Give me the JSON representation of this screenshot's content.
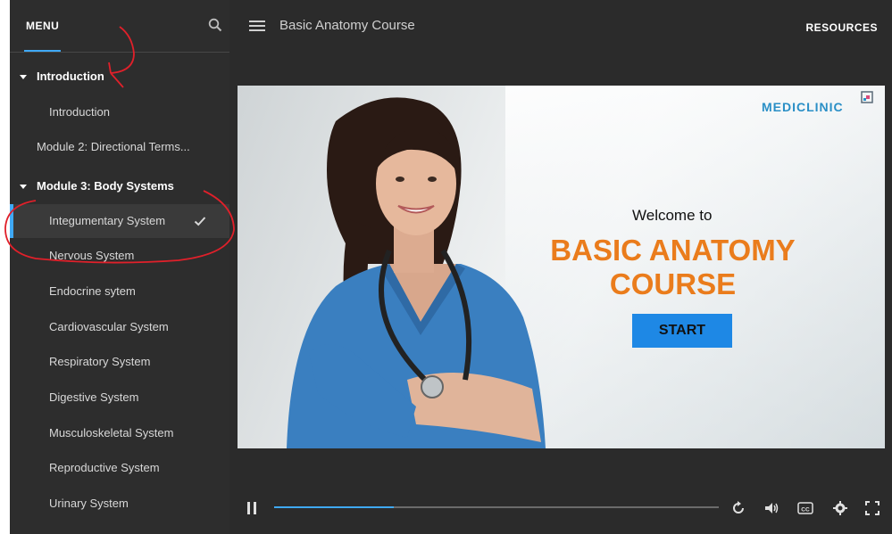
{
  "sidebar": {
    "menu_label": "MENU",
    "items": [
      {
        "label": "Introduction",
        "type": "section"
      },
      {
        "label": "Introduction",
        "type": "child"
      },
      {
        "label": "Module 2: Directional Terms...",
        "type": "top"
      },
      {
        "label": "Module 3: Body Systems",
        "type": "section"
      },
      {
        "label": "Integumentary System",
        "type": "child",
        "active": true,
        "completed": true
      },
      {
        "label": "Nervous System",
        "type": "child"
      },
      {
        "label": "Endocrine sytem",
        "type": "child"
      },
      {
        "label": "Cardiovascular System",
        "type": "child"
      },
      {
        "label": "Respiratory System",
        "type": "child"
      },
      {
        "label": "Digestive System",
        "type": "child"
      },
      {
        "label": "Musculoskeletal System",
        "type": "child"
      },
      {
        "label": "Reproductive System",
        "type": "child"
      },
      {
        "label": "Urinary System",
        "type": "child"
      }
    ]
  },
  "header": {
    "course_title": "Basic Anatomy Course",
    "resources_label": "RESOURCES"
  },
  "slide": {
    "logo": "MEDICLINIC",
    "welcome": "Welcome to",
    "title_line1": "BASIC ANATOMY",
    "title_line2": "COURSE",
    "start_label": "START"
  },
  "player": {
    "progress": 0.27,
    "icons": [
      "pause-icon",
      "replay-icon",
      "volume-icon",
      "captions-icon",
      "settings-icon",
      "fullscreen-icon"
    ]
  },
  "colors": {
    "accent": "#3fa9f5",
    "sidebar_bg": "#2d2d2d",
    "main_bg": "#2b2b2b",
    "slide_title": "#ea7c1c",
    "start_button": "#1e88e5",
    "logo": "#2a8fc6"
  }
}
